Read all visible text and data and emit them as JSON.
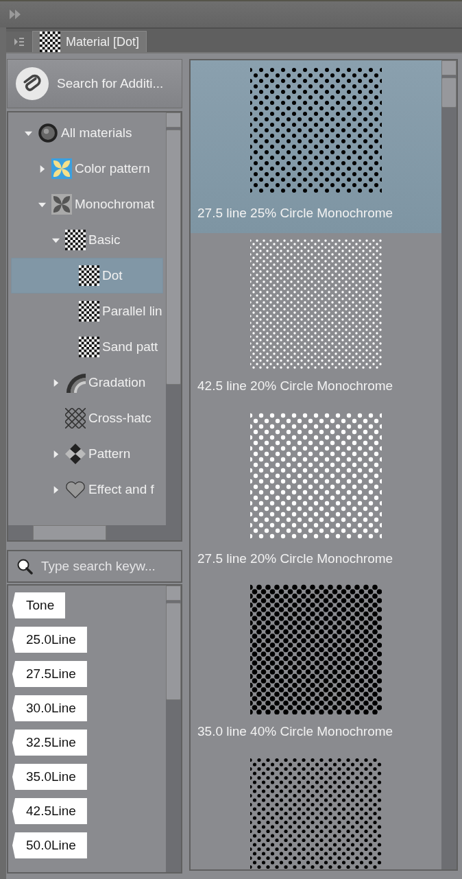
{
  "panel": {
    "tab": {
      "label": "Material [Dot]",
      "selected": true
    }
  },
  "search_button": {
    "label": "Search for Additi..."
  },
  "tree": [
    {
      "label": "All materials",
      "kind": "sphere",
      "expanded": true,
      "selected": false,
      "children": [
        {
          "label": "Color pattern",
          "kind": "clover-color",
          "expanded": false,
          "selected": false
        },
        {
          "label": "Monochromat",
          "kind": "clover-mono",
          "expanded": true,
          "selected": false,
          "children": [
            {
              "label": "Basic",
              "kind": "checker",
              "expanded": true,
              "selected": false,
              "children": [
                {
                  "label": "Dot",
                  "kind": "checker",
                  "selected": true
                },
                {
                  "label": "Parallel lin",
                  "kind": "checker",
                  "selected": false
                },
                {
                  "label": "Sand patt",
                  "kind": "checker",
                  "selected": false
                }
              ]
            },
            {
              "label": "Gradation",
              "kind": "arc",
              "expanded": false,
              "selected": false
            },
            {
              "label": "Cross-hatc",
              "kind": "crosshatch",
              "selected": false
            },
            {
              "label": "Pattern",
              "kind": "diamond",
              "expanded": false,
              "selected": false
            },
            {
              "label": "Effect and f",
              "kind": "heart",
              "expanded": false,
              "selected": false
            }
          ]
        }
      ]
    }
  ],
  "keyword_search": {
    "placeholder": "Type search keyw..."
  },
  "tags": [
    "Tone",
    "25.0Line",
    "27.5Line",
    "30.0Line",
    "32.5Line",
    "35.0Line",
    "42.5Line",
    "50.0Line"
  ],
  "materials": [
    {
      "label": "27.5 line 25% Circle Monochrome",
      "kind": "black-dots",
      "selected": true
    },
    {
      "label": "42.5 line 20% Circle Monochrome",
      "kind": "white-dots-fine",
      "selected": false
    },
    {
      "label": "27.5 line 20% Circle Monochrome",
      "kind": "white-dots",
      "selected": false
    },
    {
      "label": "35.0 line 40% Circle Monochrome",
      "kind": "black-dots-dense",
      "selected": false
    },
    {
      "kind": "black-dots-fine",
      "selected": false
    }
  ]
}
